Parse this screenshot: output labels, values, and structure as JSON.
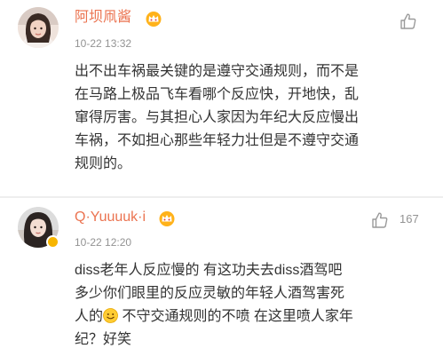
{
  "comments": [
    {
      "username": "阿坝凧酱",
      "time": "10-22 13:32",
      "likes": "",
      "verified": false,
      "lines": [
        "出不出车祸最关键的是遵守交通规则，而不是",
        "在马路上极品飞车看哪个反应快，开地快，乱",
        "窜得厉害。与其担心人家因为年纪大反应慢出",
        "车祸，不如担心那些年轻力壮但是不遵守交通",
        "规则的。"
      ]
    },
    {
      "username": "Q·Yuuuuk·i",
      "time": "10-22 12:20",
      "likes": "167",
      "verified": true,
      "lines": [
        "diss老年人反应慢的 有这功夫去diss酒驾吧",
        "多少你们眼里的反应灵敏的年轻人酒驾害死",
        "人的",
        "纪？好笑"
      ],
      "line3_after_emoji": " 不守交通规则的不喷 在这里喷人家年"
    }
  ],
  "icons": {
    "like": "thumbs-up-icon",
    "crown": "vip-crown-icon",
    "emoji": "smile-emoji-icon"
  },
  "colors": {
    "username": "#eb7350",
    "meta": "#939393",
    "text": "#333333"
  }
}
